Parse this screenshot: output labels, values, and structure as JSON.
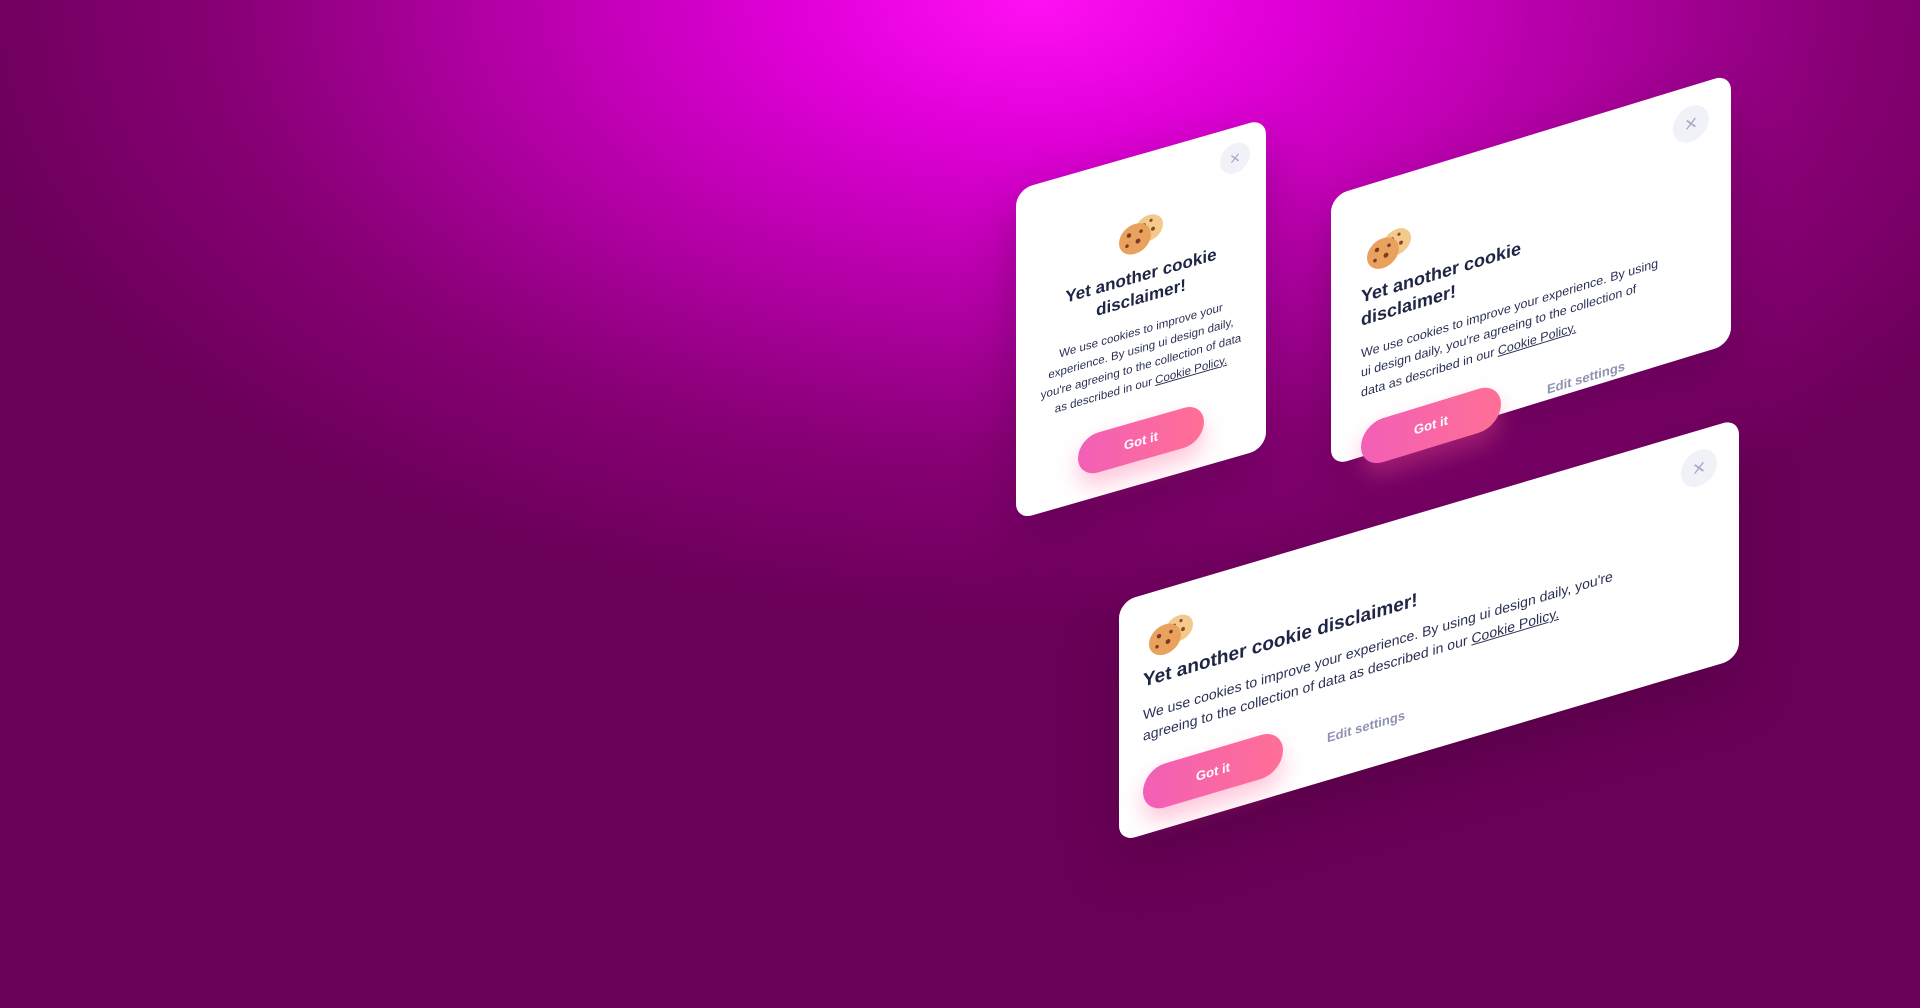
{
  "background": {
    "center_color": "#ff10f2",
    "edge_color": "#6a0058"
  },
  "accent": {
    "button_gradient_start": "#f25fb6",
    "button_gradient_end": "#ff6f95",
    "text_dark": "#1f2545",
    "muted": "#8f93b0"
  },
  "cards": {
    "small": {
      "icon": "cookie-icon",
      "close_icon": "×",
      "title": "Yet another cookie disclaimer!",
      "body": "We use cookies to improve your experience. By using ui design daily, you're agreeing to the collection of data as described in our",
      "link": "Cookie Policy.",
      "button": "Got it"
    },
    "medium": {
      "icon": "cookie-icon",
      "close_icon": "×",
      "title": "Yet another cookie disclaimer!",
      "body": "We use cookies to improve your experience. By using ui design daily, you're agreeing to the collection of data as described in our",
      "link": "Cookie Policy.",
      "button": "Got it",
      "secondary": "Edit settings"
    },
    "wide": {
      "icon": "cookie-icon",
      "close_icon": "×",
      "title": "Yet another cookie disclaimer!",
      "body": "We use cookies to improve your experience. By using ui design daily, you're agreeing to the collection of data as described in our",
      "link": "Cookie Policy.",
      "button": "Got it",
      "secondary": "Edit settings"
    }
  }
}
